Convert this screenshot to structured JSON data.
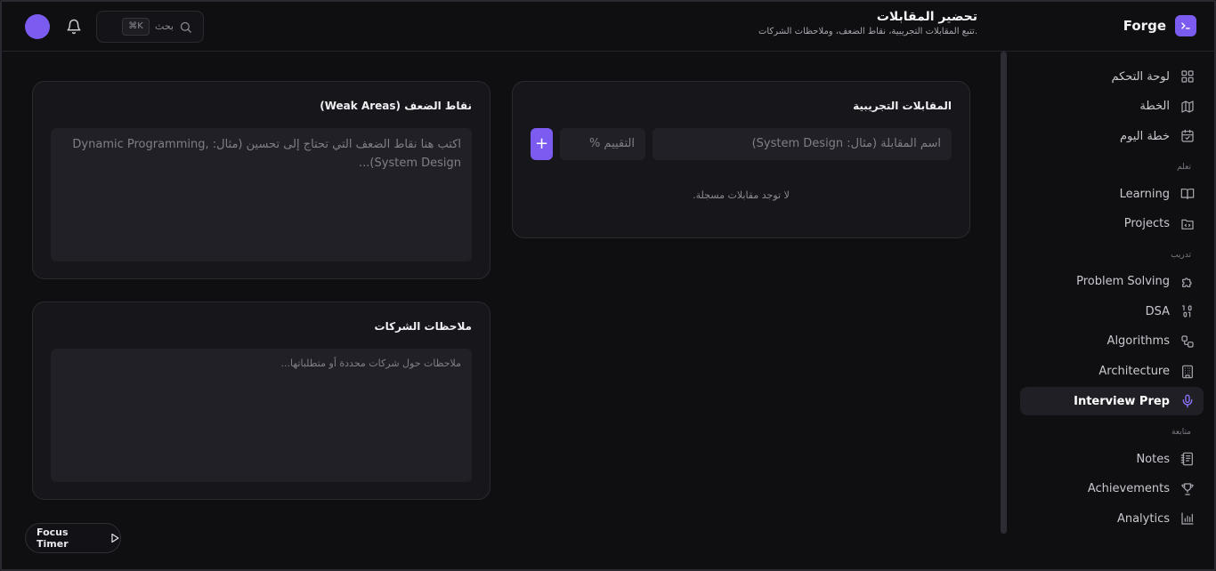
{
  "brand": {
    "name": "Forge"
  },
  "header": {
    "title": "تحضير المقابلات",
    "subtitle": "تتبع المقابلات التجريبية، نقاط الضعف، وملاحظات الشركات.",
    "search_label": "بحث",
    "search_shortcut": "⌘K"
  },
  "sidebar": {
    "top_items": [
      {
        "label": "لوحة التحكم",
        "icon": "dashboard-grid-icon"
      },
      {
        "label": "الخطة",
        "icon": "map-icon"
      },
      {
        "label": "خطة اليوم",
        "icon": "calendar-check-icon"
      }
    ],
    "section_learn": "تعلم",
    "learn_items": [
      {
        "label": "Learning",
        "icon": "book-open-icon"
      },
      {
        "label": "Projects",
        "icon": "folder-code-icon"
      }
    ],
    "section_train": "تدريب",
    "train_items": [
      {
        "label": "Problem Solving",
        "icon": "puzzle-icon"
      },
      {
        "label": "DSA",
        "icon": "binary-icon"
      },
      {
        "label": "Algorithms",
        "icon": "workflow-icon"
      },
      {
        "label": "Architecture",
        "icon": "building-icon"
      },
      {
        "label": "Interview Prep",
        "icon": "microphone-icon",
        "active": true
      }
    ],
    "section_follow": "متابعة",
    "follow_items": [
      {
        "label": "Notes",
        "icon": "notebook-icon"
      },
      {
        "label": "Achievements",
        "icon": "trophy-icon"
      },
      {
        "label": "Analytics",
        "icon": "bar-chart-icon"
      }
    ]
  },
  "mock_interviews": {
    "title": "المقابلات التجريبية",
    "name_placeholder": "اسم المقابلة (مثال: System Design)",
    "score_placeholder": "التقييم %",
    "add_label": "+",
    "empty_message": "لا توجد مقابلات مسجلة."
  },
  "weak_areas": {
    "title": "نقاط الضعف (Weak Areas)",
    "placeholder": "اكتب هنا نقاط الضعف التي تحتاج إلى تحسين (مثال: Dynamic Programming, System Design)..."
  },
  "company_notes": {
    "title": "ملاحظات الشركات",
    "placeholder": "ملاحظات حول شركات محددة أو متطلباتها..."
  },
  "focus_timer": {
    "label": "Focus Timer"
  },
  "colors": {
    "accent": "#7c5cf0",
    "background": "#0f0f12",
    "card": "#17171b"
  }
}
